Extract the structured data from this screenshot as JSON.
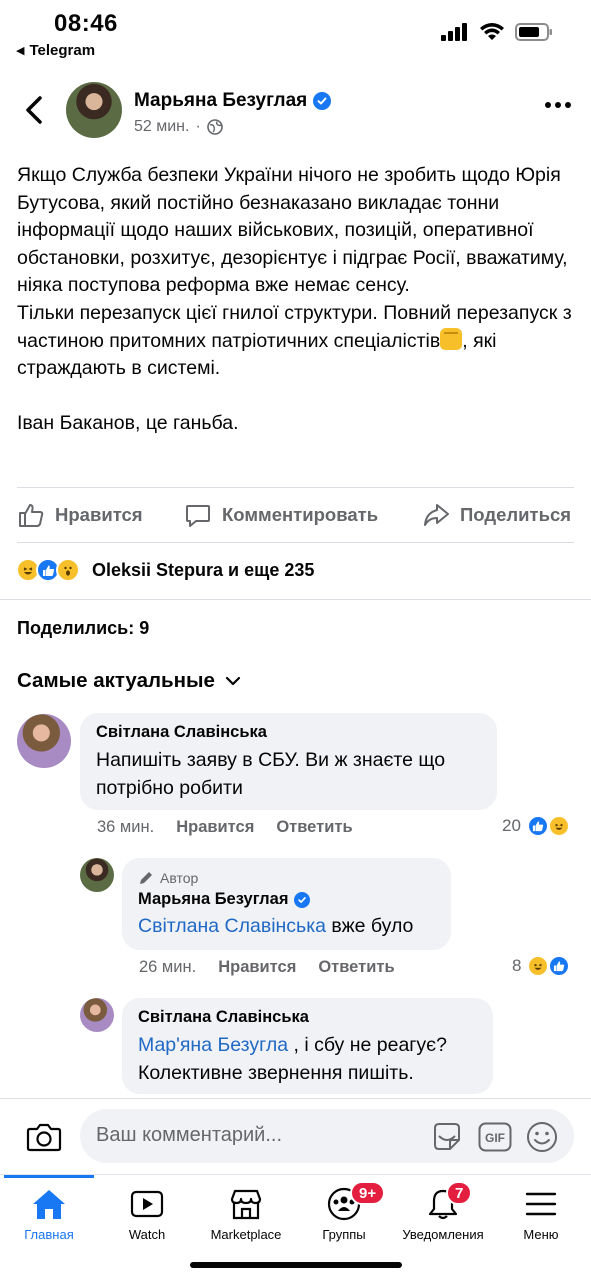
{
  "status_bar": {
    "time": "08:46",
    "back_app": "Telegram",
    "icons": [
      "cellular-signal-icon",
      "wifi-icon",
      "battery-icon"
    ]
  },
  "post": {
    "author": "Марьяна Безуглая",
    "verified": true,
    "time": "52 мин.",
    "privacy_icon": "globe-icon",
    "text": {
      "para1": "Якщо Служба безпеки України нічого не зробить щодо Юрія Бутусова, який постійно безнаказано викладає тонни інформації щодо наших військових, позицій, оперативної обстановки, розхитує, дезорієнтує і підграє Росії, вважатиму, ніяка поступова реформа вже немає сенсу.",
      "para2_start": "Тільки перезапуск цієї гнилої структури. Повний перезапуск з частиною притомних патріотичних спеціалістів",
      "para2_end": ", які страждають в системі.",
      "para3": "Іван Баканов, це ганьба."
    }
  },
  "actions": {
    "like": "Нравится",
    "comment": "Комментировать",
    "share": "Поделиться"
  },
  "reactions": {
    "icons": [
      "haha",
      "like",
      "wow"
    ],
    "summary": "Oleksii Stepura и еще 235"
  },
  "shares": "Поделились: 9",
  "sort_label": "Самые актуальные",
  "comments": [
    {
      "name": "Світлана Славінська",
      "text": "Напишіть заяву в СБУ. Ви ж знаєте  що потрібно робити",
      "time": "36 мин.",
      "like": "Нравится",
      "reply": "Ответить",
      "reaction_count": "20"
    },
    {
      "badge": "Автор",
      "name": "Марьяна Безуглая",
      "mention": "Світлана Славінська",
      "text": " вже було",
      "time": "26 мин.",
      "like": "Нравится",
      "reply": "Ответить",
      "reaction_count": "8"
    },
    {
      "name": "Світлана Славінська",
      "mention": "Мар'яна Безугла",
      "text_after_mention": " , і сбу не реагує?",
      "text_line2": "Колективне звернення пишіть."
    }
  ],
  "comment_input": {
    "placeholder": "Ваш комментарий..."
  },
  "tabs": [
    {
      "label": "Главная",
      "active": true
    },
    {
      "label": "Watch"
    },
    {
      "label": "Marketplace"
    },
    {
      "label": "Группы",
      "badge": "9+"
    },
    {
      "label": "Уведомления",
      "badge": "7"
    },
    {
      "label": "Меню"
    }
  ],
  "colors": {
    "accent": "#1877f2",
    "badge": "#e41e3f",
    "secondary_text": "#65676b",
    "bubble": "#f0f2f5",
    "mention": "#2069c5"
  }
}
